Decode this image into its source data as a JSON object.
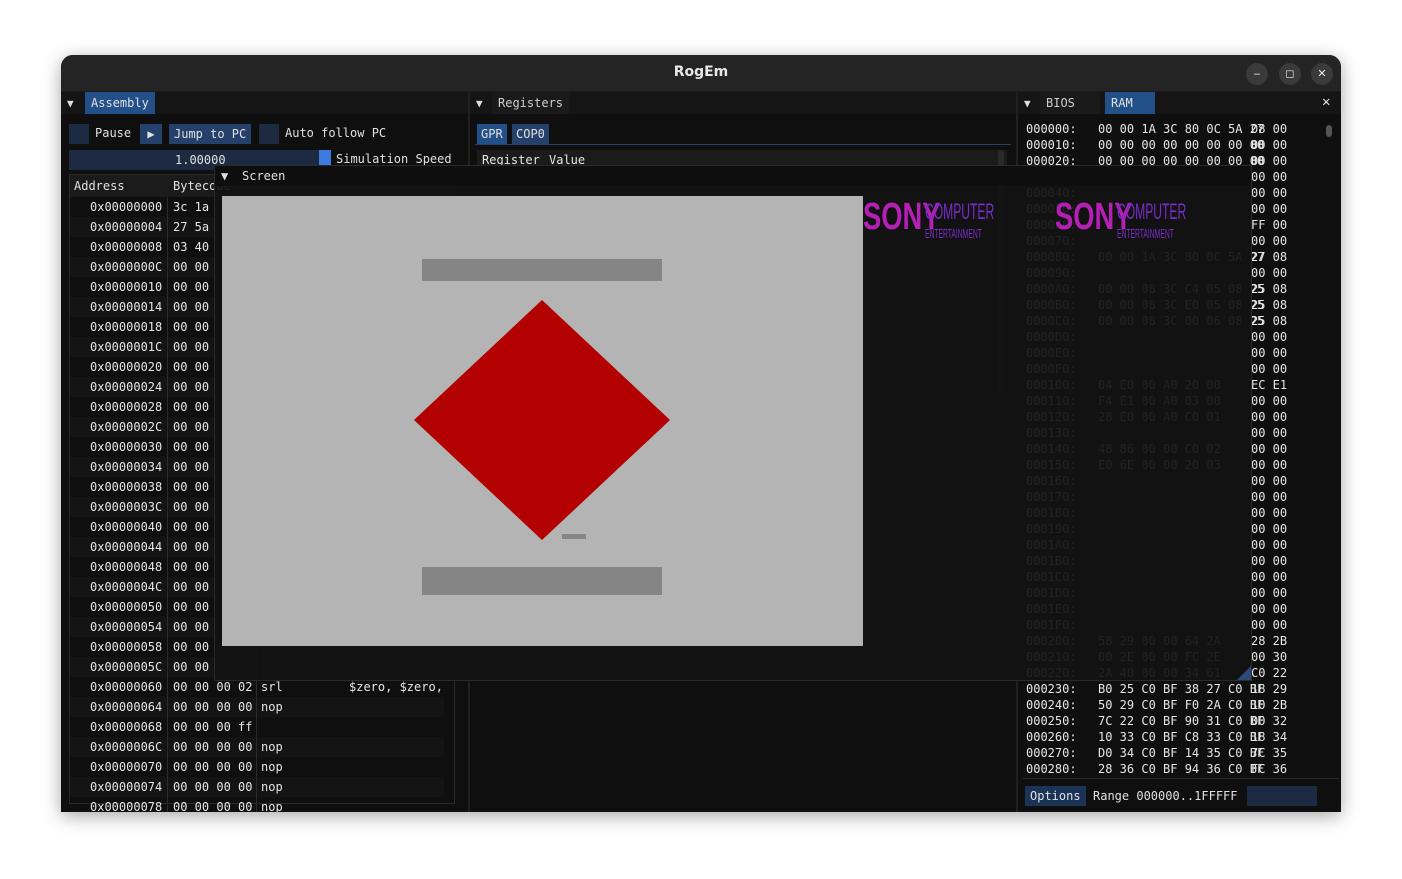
{
  "window": {
    "title": "RogEm"
  },
  "assembly": {
    "tab": "Assembly",
    "pause_label": "Pause",
    "play_icon": "play-icon",
    "jump_label": "Jump to PC",
    "auto_follow_label": "Auto follow PC",
    "speed_value": "1.00000",
    "speed_label": "Simulation Speed",
    "col_address": "Address",
    "col_bytecode": "Bytecode",
    "rows": [
      {
        "addr": "0x00000000",
        "bytes": "3c 1a",
        "instr": "",
        "args": ""
      },
      {
        "addr": "0x00000004",
        "bytes": "27 5a",
        "instr": "",
        "args": ""
      },
      {
        "addr": "0x00000008",
        "bytes": "03 40",
        "instr": "",
        "args": ""
      },
      {
        "addr": "0x0000000C",
        "bytes": "00 00",
        "instr": "",
        "args": ""
      },
      {
        "addr": "0x00000010",
        "bytes": "00 00",
        "instr": "",
        "args": ""
      },
      {
        "addr": "0x00000014",
        "bytes": "00 00",
        "instr": "",
        "args": ""
      },
      {
        "addr": "0x00000018",
        "bytes": "00 00",
        "instr": "",
        "args": ""
      },
      {
        "addr": "0x0000001C",
        "bytes": "00 00",
        "instr": "",
        "args": ""
      },
      {
        "addr": "0x00000020",
        "bytes": "00 00",
        "instr": "",
        "args": ""
      },
      {
        "addr": "0x00000024",
        "bytes": "00 00",
        "instr": "",
        "args": ""
      },
      {
        "addr": "0x00000028",
        "bytes": "00 00",
        "instr": "",
        "args": ""
      },
      {
        "addr": "0x0000002C",
        "bytes": "00 00",
        "instr": "",
        "args": ""
      },
      {
        "addr": "0x00000030",
        "bytes": "00 00",
        "instr": "",
        "args": ""
      },
      {
        "addr": "0x00000034",
        "bytes": "00 00",
        "instr": "",
        "args": ""
      },
      {
        "addr": "0x00000038",
        "bytes": "00 00",
        "instr": "",
        "args": ""
      },
      {
        "addr": "0x0000003C",
        "bytes": "00 00",
        "instr": "",
        "args": ""
      },
      {
        "addr": "0x00000040",
        "bytes": "00 00",
        "instr": "",
        "args": ""
      },
      {
        "addr": "0x00000044",
        "bytes": "00 00",
        "instr": "",
        "args": ""
      },
      {
        "addr": "0x00000048",
        "bytes": "00 00",
        "instr": "",
        "args": ""
      },
      {
        "addr": "0x0000004C",
        "bytes": "00 00",
        "instr": "",
        "args": ""
      },
      {
        "addr": "0x00000050",
        "bytes": "00 00",
        "instr": "",
        "args": ""
      },
      {
        "addr": "0x00000054",
        "bytes": "00 00",
        "instr": "",
        "args": ""
      },
      {
        "addr": "0x00000058",
        "bytes": "00 00",
        "instr": "",
        "args": ""
      },
      {
        "addr": "0x0000005C",
        "bytes": "00 00",
        "instr": "",
        "args": ""
      },
      {
        "addr": "0x00000060",
        "bytes": "00 00 00 02",
        "instr": "srl",
        "args": "$zero, $zero,"
      },
      {
        "addr": "0x00000064",
        "bytes": "00 00 00 00",
        "instr": "nop",
        "args": ""
      },
      {
        "addr": "0x00000068",
        "bytes": "00 00 00 ff",
        "instr": "",
        "args": ""
      },
      {
        "addr": "0x0000006C",
        "bytes": "00 00 00 00",
        "instr": "nop",
        "args": ""
      },
      {
        "addr": "0x00000070",
        "bytes": "00 00 00 00",
        "instr": "nop",
        "args": ""
      },
      {
        "addr": "0x00000074",
        "bytes": "00 00 00 00",
        "instr": "nop",
        "args": ""
      },
      {
        "addr": "0x00000078",
        "bytes": "00 00 00 00",
        "instr": "nop",
        "args": ""
      }
    ]
  },
  "registers": {
    "tab": "Registers",
    "subtabs": [
      "GPR",
      "COP0"
    ],
    "col_register": "Register",
    "col_value": "Value"
  },
  "memory": {
    "tabs": [
      "BIOS",
      "RAM"
    ],
    "close_icon": "close-icon",
    "rows": [
      {
        "addr": "000000:",
        "a": "00 00 1A 3C 80 0C 5A 27",
        "b": "08 00"
      },
      {
        "addr": "000010:",
        "a": "00 00 00 00 00 00 00 00",
        "b": "00 00"
      },
      {
        "addr": "000020:",
        "a": "00 00 00 00 00 00 00 00",
        "b": "00 00"
      },
      {
        "addr": "000030:",
        "a": "",
        "b": "00 00"
      },
      {
        "addr": "000040:",
        "a": "",
        "b": "00 00"
      },
      {
        "addr": "000050:",
        "a": "",
        "b": "00 00"
      },
      {
        "addr": "000060:",
        "a": "",
        "b": "FF 00"
      },
      {
        "addr": "000070:",
        "a": "",
        "b": "00 00"
      },
      {
        "addr": "000080:",
        "a": "00 00 1A 3C 80 0C 5A 27",
        "b": "27 08"
      },
      {
        "addr": "000090:",
        "a": "",
        "b": "00 00"
      },
      {
        "addr": "0000A0:",
        "a": "00 00 08 3C C4 05 08 25",
        "b": "25 08"
      },
      {
        "addr": "0000B0:",
        "a": "00 00 08 3C E0 05 08 25",
        "b": "25 08"
      },
      {
        "addr": "0000C0:",
        "a": "00 00 08 3C 00 06 08 25",
        "b": "25 08"
      },
      {
        "addr": "0000D0:",
        "a": "",
        "b": "00 00"
      },
      {
        "addr": "0000E0:",
        "a": "",
        "b": "00 00"
      },
      {
        "addr": "0000F0:",
        "a": "",
        "b": "00 00"
      },
      {
        "addr": "000100:",
        "a": "04 E0 00 A0 20 00",
        "b": "EC E1"
      },
      {
        "addr": "000110:",
        "a": "F4 E1 00 A0 03 00",
        "b": "00 00"
      },
      {
        "addr": "000120:",
        "a": "28 E0 00 A0 C0 01",
        "b": "00 00"
      },
      {
        "addr": "000130:",
        "a": "",
        "b": "00 00"
      },
      {
        "addr": "000140:",
        "a": "48 86 00 00 C0 02",
        "b": "00 00"
      },
      {
        "addr": "000150:",
        "a": "E0 6E 00 00 20 03",
        "b": "00 00"
      },
      {
        "addr": "000160:",
        "a": "",
        "b": "00 00"
      },
      {
        "addr": "000170:",
        "a": "",
        "b": "00 00"
      },
      {
        "addr": "000180:",
        "a": "",
        "b": "00 00"
      },
      {
        "addr": "000190:",
        "a": "",
        "b": "00 00"
      },
      {
        "addr": "0001A0:",
        "a": "",
        "b": "00 00"
      },
      {
        "addr": "0001B0:",
        "a": "",
        "b": "00 00"
      },
      {
        "addr": "0001C0:",
        "a": "",
        "b": "00 00"
      },
      {
        "addr": "0001D0:",
        "a": "",
        "b": "00 00"
      },
      {
        "addr": "0001E0:",
        "a": "",
        "b": "00 00"
      },
      {
        "addr": "0001F0:",
        "a": "",
        "b": "00 00"
      },
      {
        "addr": "000200:",
        "a": "58 29 00 00 64 2A",
        "b": "28 2B"
      },
      {
        "addr": "000210:",
        "a": "00 2E 00 00 FC 2E",
        "b": "00 30"
      },
      {
        "addr": "000220:",
        "a": "2A 40 00 00 34 61",
        "b": "C0 22"
      },
      {
        "addr": "000230:",
        "a": "B0 25 C0 BF 38 27 C0 BF",
        "b": "18 29"
      },
      {
        "addr": "000240:",
        "a": "50 29 C0 BF F0 2A C0 BF",
        "b": "10 2B"
      },
      {
        "addr": "000250:",
        "a": "7C 22 C0 BF 90 31 C0 BF",
        "b": "00 32"
      },
      {
        "addr": "000260:",
        "a": "10 33 C0 BF C8 33 C0 BF",
        "b": "18 34"
      },
      {
        "addr": "000270:",
        "a": "D0 34 C0 BF 14 35 C0 BF",
        "b": "7C 35"
      },
      {
        "addr": "000280:",
        "a": "28 36 C0 BF 94 36 C0 BF",
        "b": "FC 36"
      }
    ],
    "options_label": "Options",
    "range_label": "Range 000000..1FFFFF"
  },
  "screen": {
    "title": "Screen",
    "logo_main": "SONY",
    "logo_computer": "COMPUTER",
    "logo_ent": "ENTERTAINMENT",
    "diamond_color": "#b30000",
    "bg_color": "#b4b4b4",
    "bar_color": "#858585"
  }
}
